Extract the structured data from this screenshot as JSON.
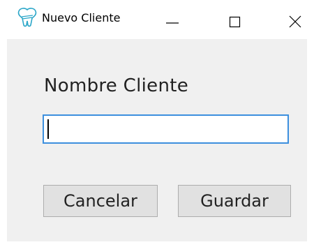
{
  "window": {
    "title": "Nuevo Cliente",
    "icon": "tooth-icon",
    "controls": [
      "minimize-icon",
      "maximize-icon",
      "close-icon"
    ]
  },
  "form": {
    "label": "Nombre Cliente",
    "input_value": "",
    "input_placeholder": ""
  },
  "buttons": {
    "cancel_label": "Cancelar",
    "save_label": "Guardar"
  },
  "colors": {
    "input_focus_border": "#3c8fde",
    "client_background": "#f0f0f0",
    "button_background": "#e1e1e1",
    "icon_accent": "#2aa6c8"
  }
}
